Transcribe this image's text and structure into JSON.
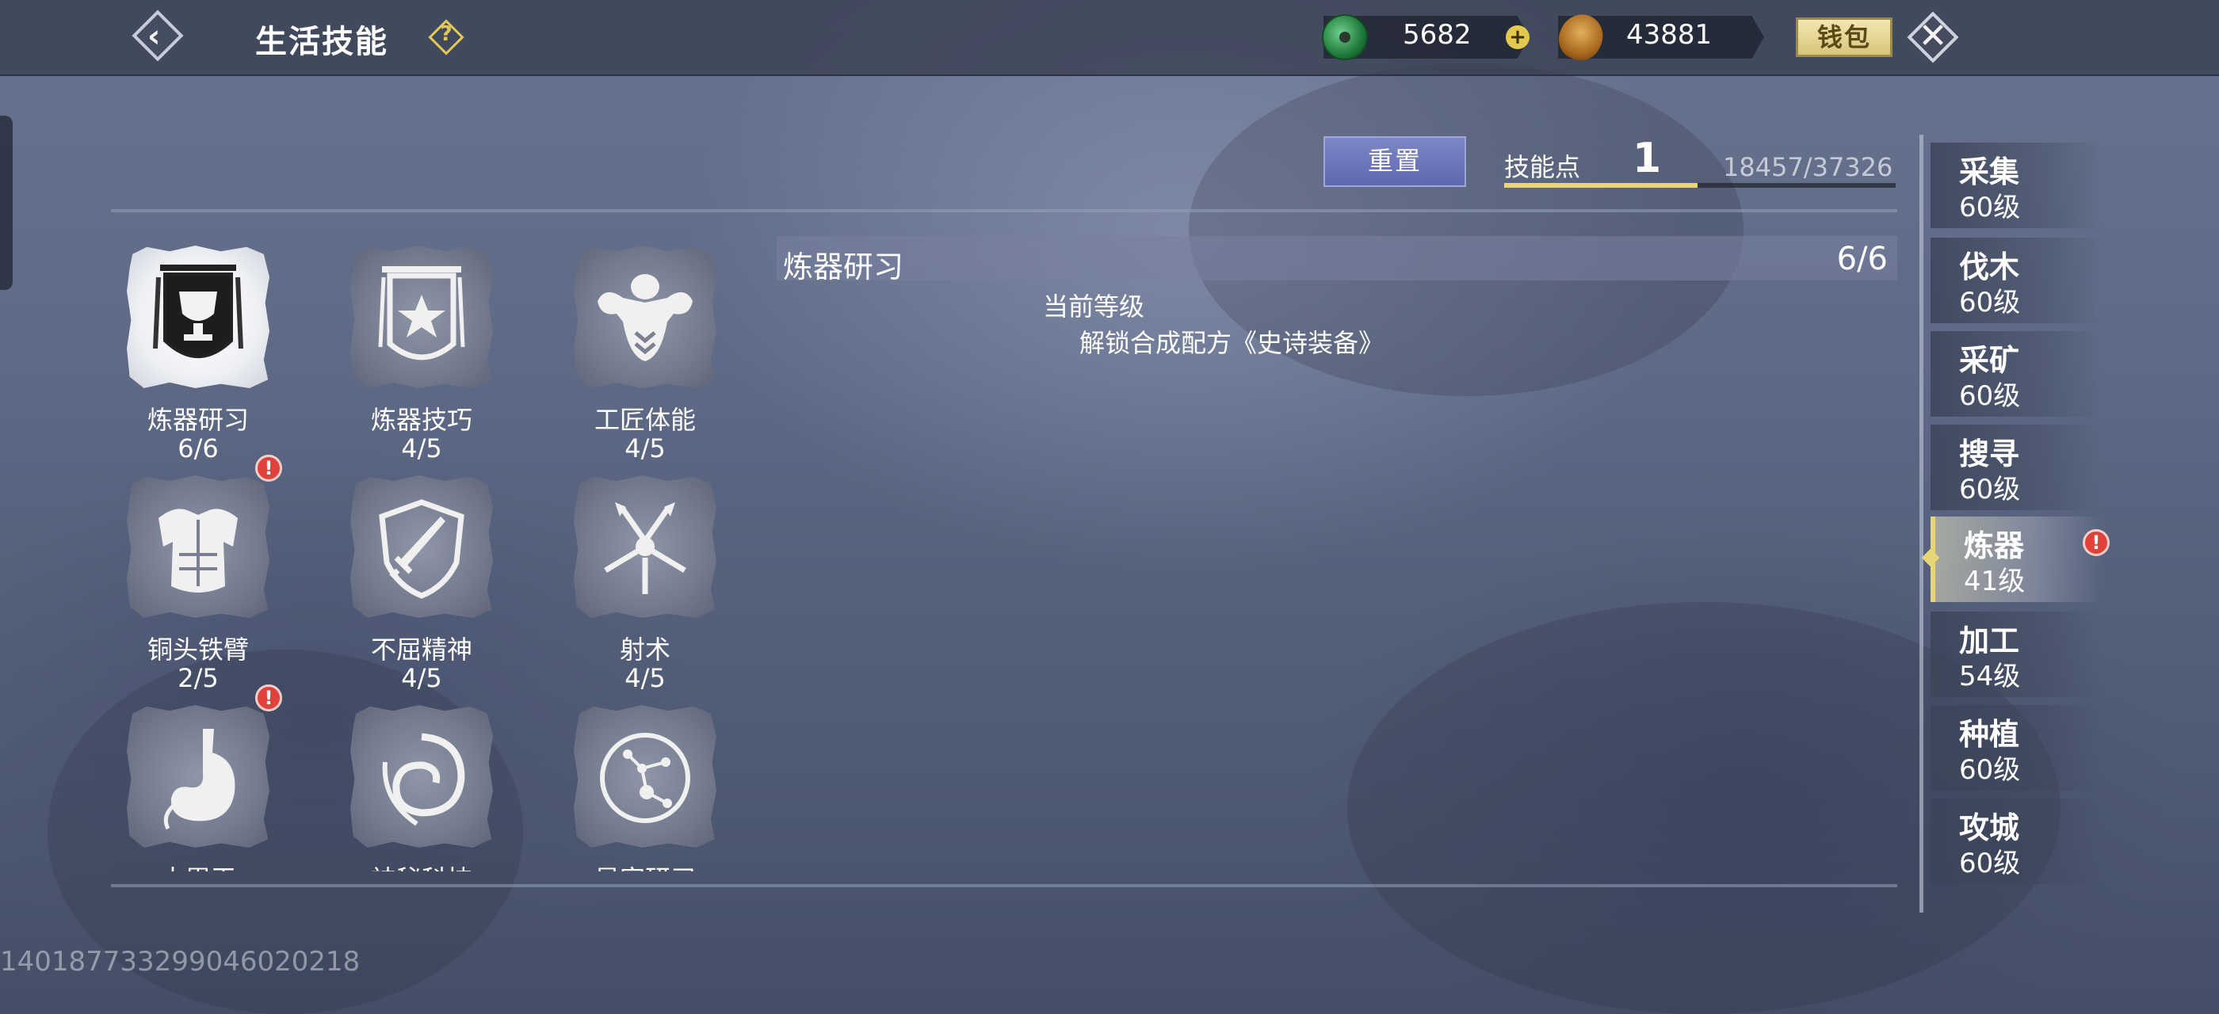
{
  "header": {
    "title": "生活技能",
    "back_icon": "chevron-left-icon",
    "help_icon": "question-icon",
    "jade_amount": "5682",
    "copper_amount": "43881",
    "wallet_label": "钱包",
    "close_icon": "close-icon"
  },
  "skill_points": {
    "reset_label": "重置",
    "label": "技能点",
    "value": "1",
    "exp_text": "18457/37326",
    "exp_fraction": 0.494
  },
  "skills": [
    {
      "name": "炼器研习",
      "level": "6/6",
      "icon": "trophy-banner-icon",
      "selected": true,
      "alert": false
    },
    {
      "name": "炼器技巧",
      "level": "4/5",
      "icon": "star-banner-icon",
      "selected": false,
      "alert": false
    },
    {
      "name": "工匠体能",
      "level": "4/5",
      "icon": "muscle-torso-icon",
      "selected": false,
      "alert": false
    },
    {
      "name": "铜头铁臂",
      "level": "2/5",
      "icon": "armor-chest-icon",
      "selected": false,
      "alert": true
    },
    {
      "name": "不屈精神",
      "level": "4/5",
      "icon": "shield-sword-icon",
      "selected": false,
      "alert": false
    },
    {
      "name": "射术",
      "level": "4/5",
      "icon": "archery-burst-icon",
      "selected": false,
      "alert": false
    },
    {
      "name": "大胃王",
      "level": "",
      "icon": "stomach-icon",
      "selected": false,
      "alert": true
    },
    {
      "name": "神秘科技",
      "level": "",
      "icon": "vortex-icon",
      "selected": false,
      "alert": false
    },
    {
      "name": "星宿研习",
      "level": "",
      "icon": "constellation-icon",
      "selected": false,
      "alert": false
    }
  ],
  "detail": {
    "title": "炼器研习",
    "level": "6/6",
    "current_level_label": "当前等级",
    "description": "解锁合成配方《史诗装备》"
  },
  "categories": [
    {
      "name": "采集",
      "level": "60级",
      "active": false,
      "alert": false
    },
    {
      "name": "伐木",
      "level": "60级",
      "active": false,
      "alert": false
    },
    {
      "name": "采矿",
      "level": "60级",
      "active": false,
      "alert": false
    },
    {
      "name": "搜寻",
      "level": "60级",
      "active": false,
      "alert": false
    },
    {
      "name": "炼器",
      "level": "41级",
      "active": true,
      "alert": true
    },
    {
      "name": "加工",
      "level": "54级",
      "active": false,
      "alert": false
    },
    {
      "name": "种植",
      "level": "60级",
      "active": false,
      "alert": false
    },
    {
      "name": "攻城",
      "level": "60级",
      "active": false,
      "alert": false
    }
  ],
  "uid": "140187733299046020218",
  "colors": {
    "accent": "#e8d676",
    "alert": "#e0413a",
    "reset": "#6f79be"
  }
}
